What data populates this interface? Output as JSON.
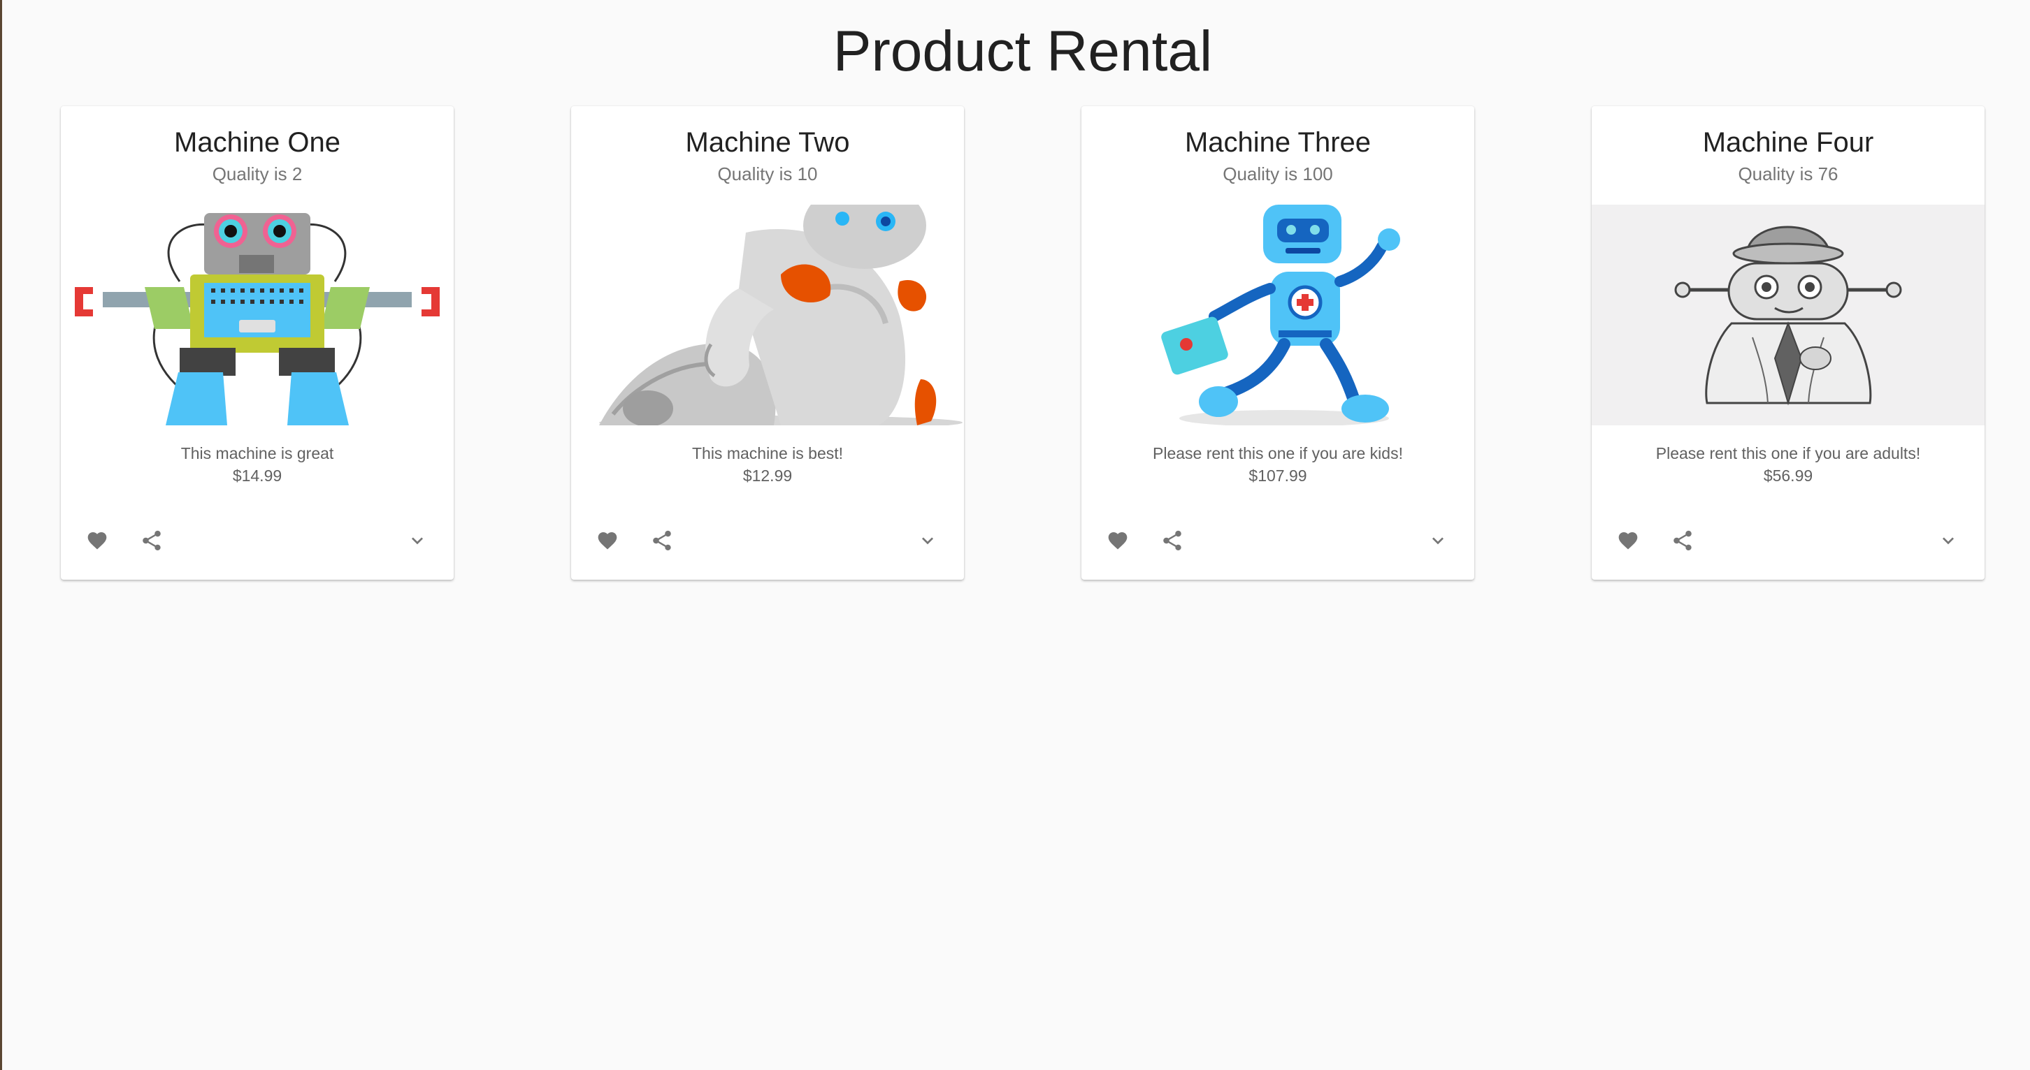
{
  "page": {
    "title": "Product Rental"
  },
  "icons": {
    "favorite": "heart-icon",
    "share": "share-icon",
    "expand": "chevron-down-icon"
  },
  "colors": {
    "background": "#fafafa",
    "card": "#ffffff",
    "icon": "#757575",
    "subtitle": "#757575",
    "text": "#212121"
  },
  "cards": [
    {
      "title": "Machine One",
      "subtitle": "Quality is 2",
      "description": "This machine is great",
      "price": "$14.99"
    },
    {
      "title": "Machine Two",
      "subtitle": "Quality is 10",
      "description": "This machine is best!",
      "price": "$12.99"
    },
    {
      "title": "Machine Three",
      "subtitle": "Quality is 100",
      "description": "Please rent this one if you are kids!",
      "price": "$107.99"
    },
    {
      "title": "Machine Four",
      "subtitle": "Quality is 76",
      "description": "Please rent this one if you are adults!",
      "price": "$56.99"
    }
  ]
}
